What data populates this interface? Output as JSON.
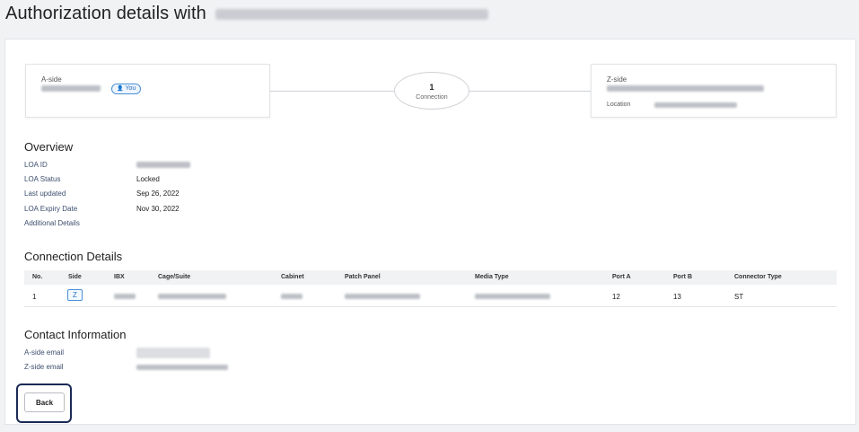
{
  "page": {
    "title": "Authorization details with"
  },
  "connection_summary": {
    "a_side_label": "A-side",
    "you_badge": "You",
    "connection_count": "1",
    "connection_label": "Connection",
    "z_side_label": "Z-side",
    "location_label": "Location"
  },
  "overview": {
    "title": "Overview",
    "rows": [
      {
        "label": "LOA ID",
        "value": ""
      },
      {
        "label": "LOA Status",
        "value": "Locked"
      },
      {
        "label": "Last updated",
        "value": "Sep 26, 2022"
      },
      {
        "label": "LOA Expiry Date",
        "value": "Nov 30, 2022"
      },
      {
        "label": "Additional Details",
        "value": ""
      }
    ]
  },
  "connection_details": {
    "title": "Connection Details",
    "columns": [
      "No.",
      "Side",
      "IBX",
      "Cage/Suite",
      "Cabinet",
      "Patch Panel",
      "Media Type",
      "Port A",
      "Port B",
      "Connector Type"
    ],
    "rows": [
      {
        "no": "1",
        "side": "Z",
        "port_a": "12",
        "port_b": "13",
        "connector_type": "ST"
      }
    ]
  },
  "contact": {
    "title": "Contact Information",
    "a_side_email_label": "A-side email",
    "z_side_email_label": "Z-side email"
  },
  "actions": {
    "back_label": "Back"
  },
  "colors": {
    "accent": "#4a8fd6",
    "focus_ring": "#1a2a55",
    "table_header_bg": "#f1f2f4"
  }
}
